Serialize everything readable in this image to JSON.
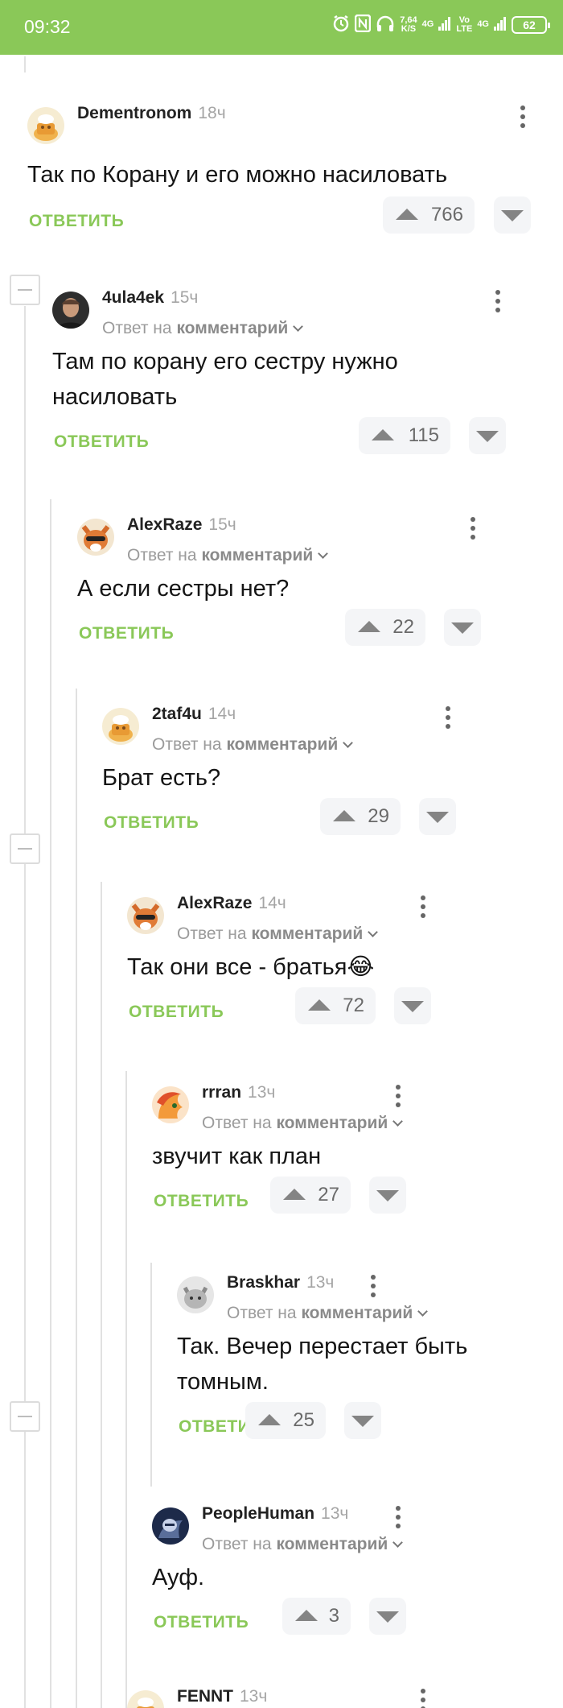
{
  "status_bar": {
    "time": "09:32",
    "speed": "7,64",
    "speed_unit": "K/S",
    "net1": "4G",
    "volte_top": "Vo",
    "volte_bottom": "LTE",
    "net2": "4G",
    "battery": "62"
  },
  "comments": [
    {
      "author": "Dementronom",
      "time": "18ч",
      "reply_prefix": "",
      "reply_link": "",
      "text_lines": [
        "Так по Корану и его можно насиловать"
      ],
      "reply_label": "ОТВЕТИТЬ",
      "votes": "766",
      "avatar": "cook-avatar"
    },
    {
      "author": "4ula4ek",
      "time": "15ч",
      "reply_prefix": "Ответ на",
      "reply_link": "комментарий",
      "text_lines": [
        "Там по корану его сестру нужно",
        "насиловать"
      ],
      "reply_label": "ОТВЕТИТЬ",
      "votes": "115",
      "avatar": "man-photo"
    },
    {
      "author": "AlexRaze",
      "time": "15ч",
      "reply_prefix": "Ответ на",
      "reply_link": "комментарий",
      "text_lines": [
        "А если сестры нет?"
      ],
      "reply_label": "ОТВЕТИТЬ",
      "votes": "22",
      "avatar": "fox-avatar"
    },
    {
      "author": "2taf4u",
      "time": "14ч",
      "reply_prefix": "Ответ на",
      "reply_link": "комментарий",
      "text_lines": [
        "Брат есть?"
      ],
      "reply_label": "ОТВЕТИТЬ",
      "votes": "29",
      "avatar": "cook-avatar"
    },
    {
      "author": "AlexRaze",
      "time": "14ч",
      "reply_prefix": "Ответ на",
      "reply_link": "комментарий",
      "text_lines": [
        "Так они все - братья😂"
      ],
      "reply_label": "ОТВЕТИТЬ",
      "votes": "72",
      "avatar": "fox-avatar"
    },
    {
      "author": "rrran",
      "time": "13ч",
      "reply_prefix": "Ответ на",
      "reply_link": "комментарий",
      "text_lines": [
        "звучит как план"
      ],
      "reply_label": "ОТВЕТИТЬ",
      "votes": "27",
      "avatar": "pony-avatar"
    },
    {
      "author": "Braskhar",
      "time": "13ч",
      "reply_prefix": "Ответ на",
      "reply_link": "комментарий",
      "text_lines": [
        "Так. Вечер перестает быть",
        "томным."
      ],
      "reply_label": "ОТВЕТИТЬ",
      "votes": "25",
      "avatar": "cat-photo"
    },
    {
      "author": "PeopleHuman",
      "time": "13ч",
      "reply_prefix": "Ответ на",
      "reply_link": "комментарий",
      "text_lines": [
        "Ауф."
      ],
      "reply_label": "ОТВЕТИТЬ",
      "votes": "3",
      "avatar": "knight-avatar"
    },
    {
      "author": "FENNT",
      "time": "13ч",
      "reply_prefix": "",
      "reply_link": "",
      "text_lines": [],
      "reply_label": "",
      "votes": "",
      "avatar": "cook-avatar"
    }
  ]
}
